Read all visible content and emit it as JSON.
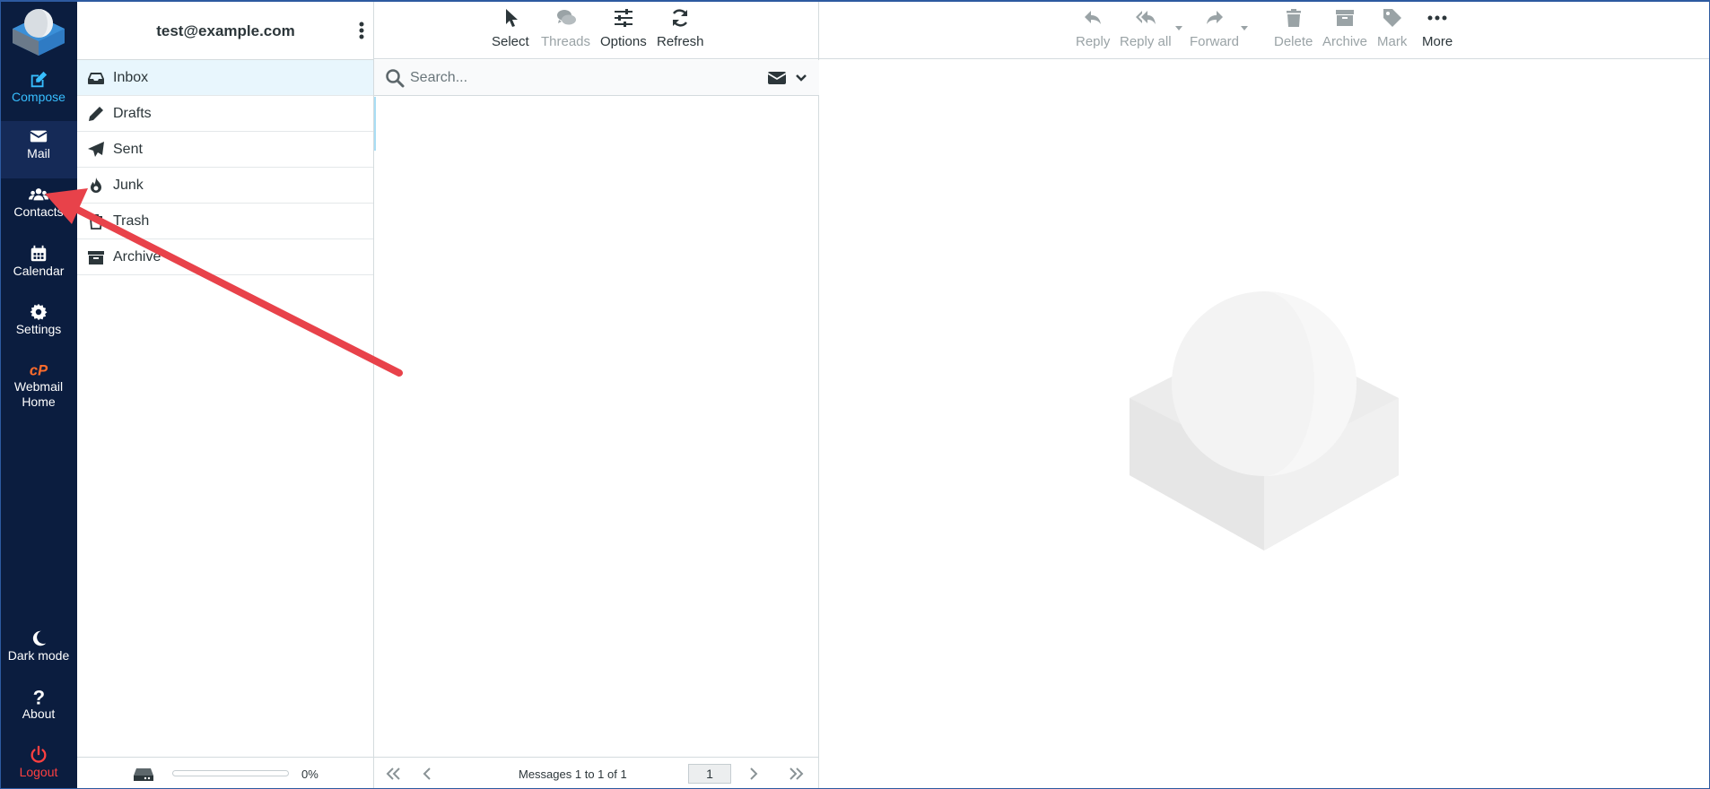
{
  "nav": {
    "compose": "Compose",
    "mail": "Mail",
    "contacts": "Contacts",
    "calendar": "Calendar",
    "settings": "Settings",
    "webmail_home_line1": "Webmail",
    "webmail_home_line2": "Home",
    "dark_mode": "Dark mode",
    "about": "About",
    "logout": "Logout"
  },
  "account": "test@example.com",
  "folders": [
    {
      "label": "Inbox",
      "icon": "inbox-icon",
      "selected": true
    },
    {
      "label": "Drafts",
      "icon": "pencil-icon"
    },
    {
      "label": "Sent",
      "icon": "paper-plane-icon"
    },
    {
      "label": "Junk",
      "icon": "fire-icon"
    },
    {
      "label": "Trash",
      "icon": "trash-icon"
    },
    {
      "label": "Archive",
      "icon": "archive-icon"
    }
  ],
  "quota": {
    "percent_text": "0%",
    "used_fraction": 0
  },
  "list_toolbar": {
    "select": "Select",
    "threads": "Threads",
    "options": "Options",
    "refresh": "Refresh"
  },
  "search": {
    "placeholder": "Search..."
  },
  "list_footer": {
    "count": "Messages 1 to 1 of 1",
    "page": "1"
  },
  "preview_toolbar": {
    "reply": "Reply",
    "reply_all": "Reply all",
    "forward": "Forward",
    "delete": "Delete",
    "archive": "Archive",
    "mark": "Mark",
    "more": "More"
  },
  "colors": {
    "nav_bg": "#0b1d3f",
    "accent": "#37beff",
    "logout": "#ff4040",
    "arrow": "#e8424a"
  }
}
